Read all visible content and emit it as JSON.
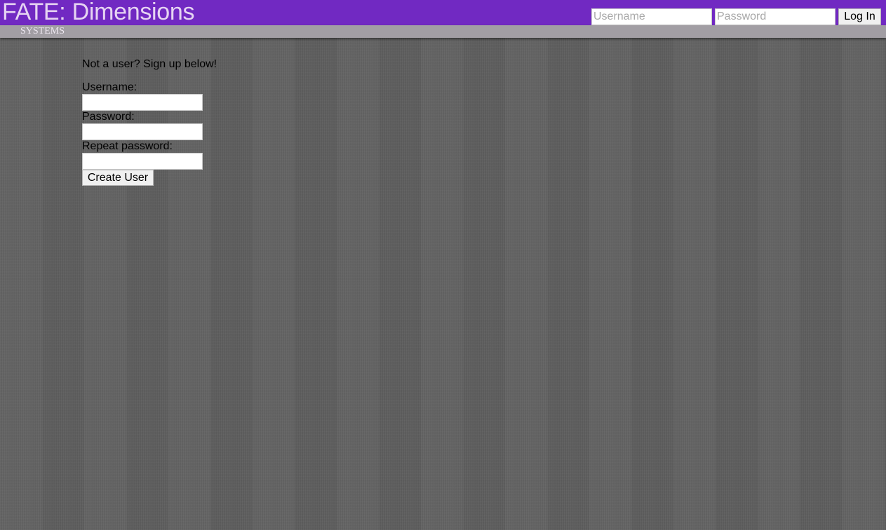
{
  "header": {
    "title": "FATE: Dimensions",
    "login": {
      "username_placeholder": "Username",
      "password_placeholder": "Password",
      "login_label": "Log In"
    }
  },
  "nav": {
    "items": [
      {
        "label": "SYSTEMS"
      }
    ]
  },
  "signup": {
    "intro": "Not a user? Sign up below!",
    "username_label": "Username:",
    "password_label": "Password:",
    "repeat_password_label": "Repeat password:",
    "submit_label": "Create User"
  },
  "colors": {
    "header_bg": "#7129c2",
    "title_text": "#e6d4f2",
    "nav_bg": "#a29ea4",
    "page_bg": "#5f5f5f"
  }
}
